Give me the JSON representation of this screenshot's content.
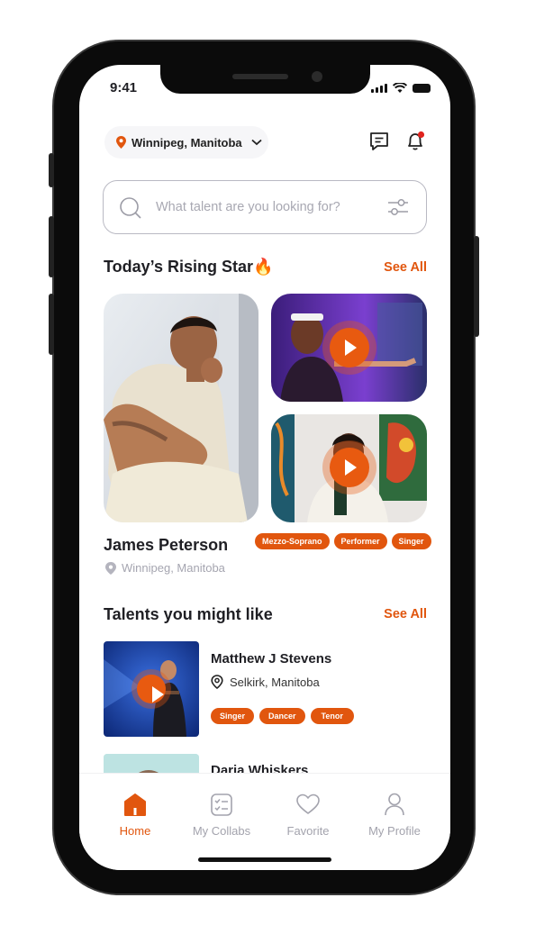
{
  "status": {
    "time": "9:41"
  },
  "header": {
    "location": "Winnipeg, Manitoba"
  },
  "search": {
    "placeholder": "What talent are you looking for?"
  },
  "rising": {
    "title": "Today’s Rising Star🔥",
    "see_all": "See All",
    "name": "James Peterson",
    "location": "Winnipeg, Manitoba",
    "tags": [
      "Mezzo-Soprano",
      "Performer",
      "Singer"
    ]
  },
  "talents": {
    "title": "Talents you might like",
    "see_all": "See All",
    "items": [
      {
        "name": "Matthew J Stevens",
        "location": "Selkirk, Manitoba",
        "tags": [
          "Singer",
          "Dancer",
          "Tenor"
        ]
      },
      {
        "name": "Daria Whiskers"
      }
    ]
  },
  "nav": {
    "tabs": [
      {
        "label": "Home",
        "icon": "home-icon",
        "active": true
      },
      {
        "label": "My Collabs",
        "icon": "collabs-icon",
        "active": false
      },
      {
        "label": "Favorite",
        "icon": "heart-icon",
        "active": false
      },
      {
        "label": "My Profile",
        "icon": "profile-icon",
        "active": false
      }
    ]
  },
  "colors": {
    "accent": "#e1560e",
    "text": "#1f1f24",
    "muted": "#a5a5b0"
  }
}
